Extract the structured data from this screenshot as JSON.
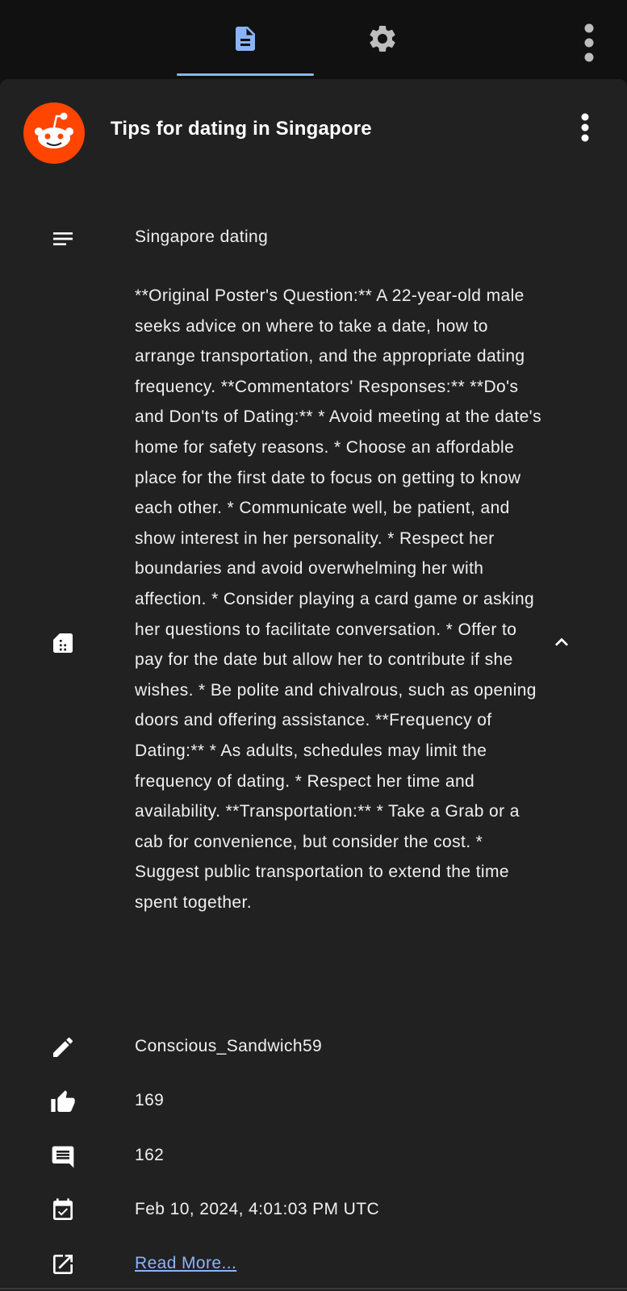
{
  "tabs": [
    {
      "icon": "document-icon",
      "active": true
    },
    {
      "icon": "gear-icon",
      "active": false
    }
  ],
  "colors": {
    "accent": "#8ab4f8",
    "reddit_orange": "#ff4500",
    "card_bg": "#212121",
    "page_bg": "#111111"
  },
  "post": {
    "title": "Tips for dating in Singapore",
    "subtitle": "Singapore dating",
    "summary": "**Original Poster's Question:** A 22-year-old male seeks advice on where to take a date, how to arrange transportation, and the appropriate dating frequency. **Commentators' Responses:** **Do's and Don'ts of Dating:** * Avoid meeting at the date's home for safety reasons. * Choose an affordable place for the first date to focus on getting to know each other. * Communicate well, be patient, and show interest in her personality. * Respect her boundaries and avoid overwhelming her with affection. * Consider playing a card game or asking her questions to facilitate conversation. * Offer to pay for the date but allow her to contribute if she wishes. * Be polite and chivalrous, such as opening doors and offering assistance. **Frequency of Dating:** * As adults, schedules may limit the frequency of dating. * Respect her time and availability. **Transportation:** * Take a Grab or a cab for convenience, but consider the cost. * Suggest public transportation to extend the time spent together.",
    "author": "Conscious_Sandwich59",
    "upvotes": "169",
    "comments": "162",
    "date": "Feb 10, 2024, 4:01:03 PM UTC",
    "read_more": "Read More..."
  }
}
